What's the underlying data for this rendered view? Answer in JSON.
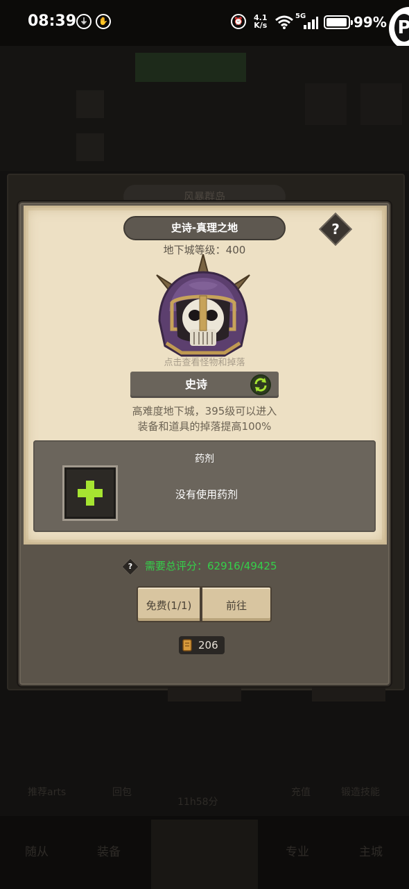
{
  "status_bar": {
    "time": "08:39",
    "net_speed_top": "4.1",
    "net_speed_unit": "K/s",
    "signal_label": "5G",
    "battery_percent": "99%"
  },
  "background": {
    "region_title": "风暴群岛",
    "nav_items": [
      "随从",
      "装备",
      "专业",
      "主城"
    ],
    "mid_items": [
      "推荐arts",
      "回包",
      "11h58分",
      "充值",
      "锻造技能"
    ]
  },
  "modal": {
    "title": "史诗-真理之地",
    "help_symbol": "?",
    "dungeon_level": "地下城等级：400",
    "hint": "点击查看怪物和掉落",
    "difficulty_label": "史诗",
    "desc_line1": "高难度地下城，395级可以进入",
    "desc_line2": "装备和道具的掉落提高100%",
    "potion_title": "药剂",
    "potion_empty": "没有使用药剂",
    "score_help_symbol": "?",
    "score_text": "需要总评分：62916/49425",
    "free_button": "免费(1/1)",
    "go_button": "前往",
    "cost_value": "206"
  },
  "colors": {
    "score_green": "#35d04a",
    "parchment": "#ede0c4",
    "plus_green": "#a6e431"
  }
}
